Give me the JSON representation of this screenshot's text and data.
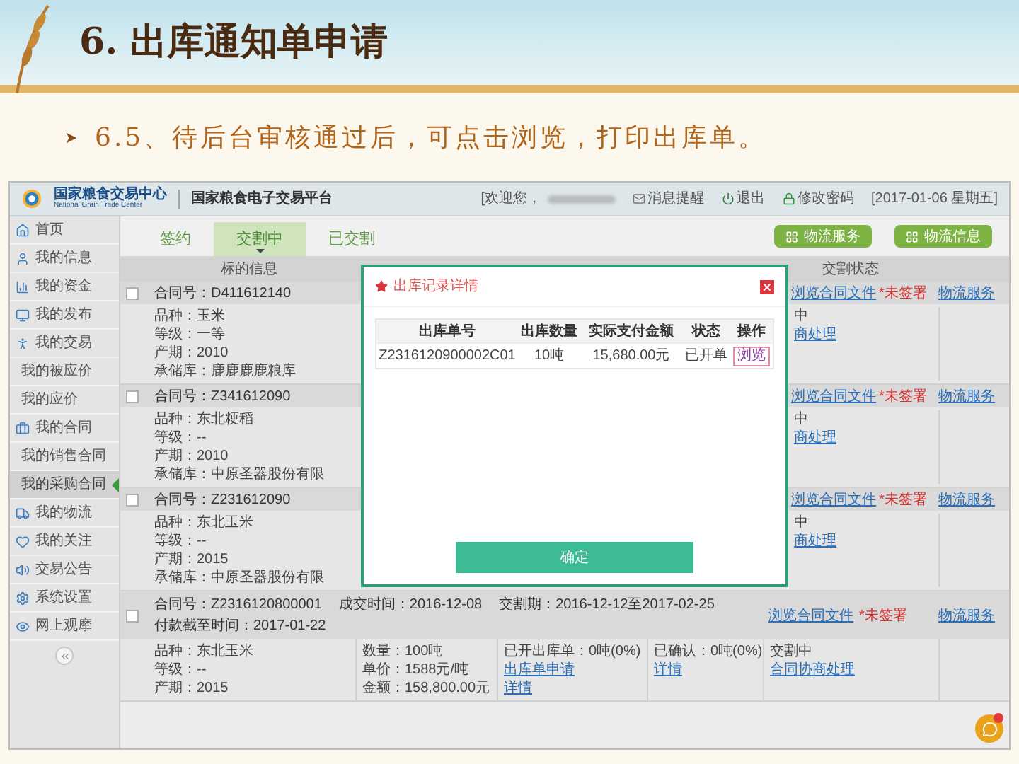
{
  "slide": {
    "title": "6. 出库通知单申请",
    "bullet": "6.5、待后台审核通过后，可点击浏览，打印出库单。"
  },
  "app": {
    "logo": {
      "name": "国家粮食交易中心",
      "subtitle": "National Grain Trade Center"
    },
    "platform_title": "国家粮食电子交易平台",
    "welcome": "[欢迎您，",
    "header_links": [
      {
        "kind": "mail",
        "label": "消息提醒"
      },
      {
        "kind": "power",
        "label": "退出"
      },
      {
        "kind": "lock",
        "label": "修改密码"
      }
    ],
    "date": "[2017-01-06 星期五]",
    "sidebar": [
      {
        "label": "首页",
        "kind": "main",
        "selected": false
      },
      {
        "label": "我的信息",
        "kind": "main",
        "selected": false
      },
      {
        "label": "我的资金",
        "kind": "main",
        "selected": false
      },
      {
        "label": "我的发布",
        "kind": "main",
        "selected": false
      },
      {
        "label": "我的交易",
        "kind": "main",
        "selected": false
      },
      {
        "label": "我的被应价",
        "kind": "sub",
        "selected": false
      },
      {
        "label": "我的应价",
        "kind": "sub",
        "selected": false
      },
      {
        "label": "我的合同",
        "kind": "main",
        "selected": false
      },
      {
        "label": "我的销售合同",
        "kind": "sub",
        "selected": false
      },
      {
        "label": "我的采购合同",
        "kind": "sub",
        "selected": true
      },
      {
        "label": "我的物流",
        "kind": "main",
        "selected": false
      },
      {
        "label": "我的关注",
        "kind": "main",
        "selected": false
      },
      {
        "label": "交易公告",
        "kind": "main",
        "selected": false
      },
      {
        "label": "系统设置",
        "kind": "main",
        "selected": false
      },
      {
        "label": "网上观摩",
        "kind": "main",
        "selected": false
      }
    ],
    "tabs": [
      {
        "label": "签约",
        "selected": false
      },
      {
        "label": "交割中",
        "selected": true
      },
      {
        "label": "已交割",
        "selected": false
      }
    ],
    "action_buttons": [
      "物流服务",
      "物流信息"
    ],
    "table_columns": [
      "标的信息",
      "交割状态"
    ],
    "contracts": [
      {
        "contract_no": "合同号：D411612140",
        "checked": false,
        "details": [
          "品种：玉米",
          "等级：一等",
          "产期：2010"
        ],
        "warehouse": "承储库：鹿鹿鹿鹿粮库",
        "status_fragments": [
          "中",
          "商处理"
        ],
        "file_link": "浏览合同文件",
        "sign_status": "*未签署",
        "logistics_link": "物流服务"
      },
      {
        "contract_no": "合同号：Z341612090",
        "checked": false,
        "details": [
          "品种：东北粳稻",
          "等级：--",
          "产期：2010"
        ],
        "warehouse": "承储库：中原圣器股份有限",
        "status_fragments": [
          "中",
          "商处理"
        ],
        "file_link": "浏览合同文件",
        "sign_status": "*未签署",
        "logistics_link": "物流服务"
      },
      {
        "contract_no": "合同号：Z231612090",
        "checked": false,
        "details": [
          "品种：东北玉米",
          "等级：--",
          "产期：2015"
        ],
        "warehouse": "承储库：中原圣器股份有限",
        "status_fragments": [
          "中",
          "商处理"
        ],
        "file_link": "浏览合同文件",
        "sign_status": "*未签署",
        "logistics_link": "物流服务"
      }
    ],
    "full_contract": {
      "checked": false,
      "header": [
        "合同号：Z2316120800001",
        "成交时间：2016-12-08",
        "交割期：2016-12-12至2017-02-25",
        "付款截至时间：2017-01-22"
      ],
      "file_link": "浏览合同文件",
      "sign_status": "*未签署",
      "logistics_link": "物流服务",
      "columns": [
        [
          {
            "kind": "text",
            "text": "品种：东北玉米"
          },
          {
            "kind": "text",
            "text": "等级：--"
          },
          {
            "kind": "text",
            "text": "产期：2015"
          }
        ],
        [
          {
            "kind": "text",
            "text": "数量：100吨"
          },
          {
            "kind": "text",
            "text": "单价：1588元/吨"
          },
          {
            "kind": "text",
            "text": "金额：158,800.00元"
          }
        ],
        [
          {
            "kind": "text",
            "text": "已开出库单：0吨(0%)"
          },
          {
            "kind": "link",
            "text": "出库单申请"
          },
          {
            "kind": "link",
            "text": "详情"
          }
        ],
        [
          {
            "kind": "text",
            "text": "已确认：0吨(0%)"
          },
          {
            "kind": "link",
            "text": "详情"
          }
        ],
        [
          {
            "kind": "text",
            "text": "交割中"
          },
          {
            "kind": "link",
            "text": "合同协商处理"
          }
        ]
      ]
    }
  },
  "modal": {
    "title": "出库记录详情",
    "columns": [
      "出库单号",
      "出库数量",
      "实际支付金额",
      "状态",
      "操作"
    ],
    "rows": [
      {
        "cells": [
          "Z2316120900002C01",
          "10吨",
          "15,680.00元",
          "已开单"
        ],
        "action": "浏览"
      }
    ],
    "confirm": "确定"
  }
}
